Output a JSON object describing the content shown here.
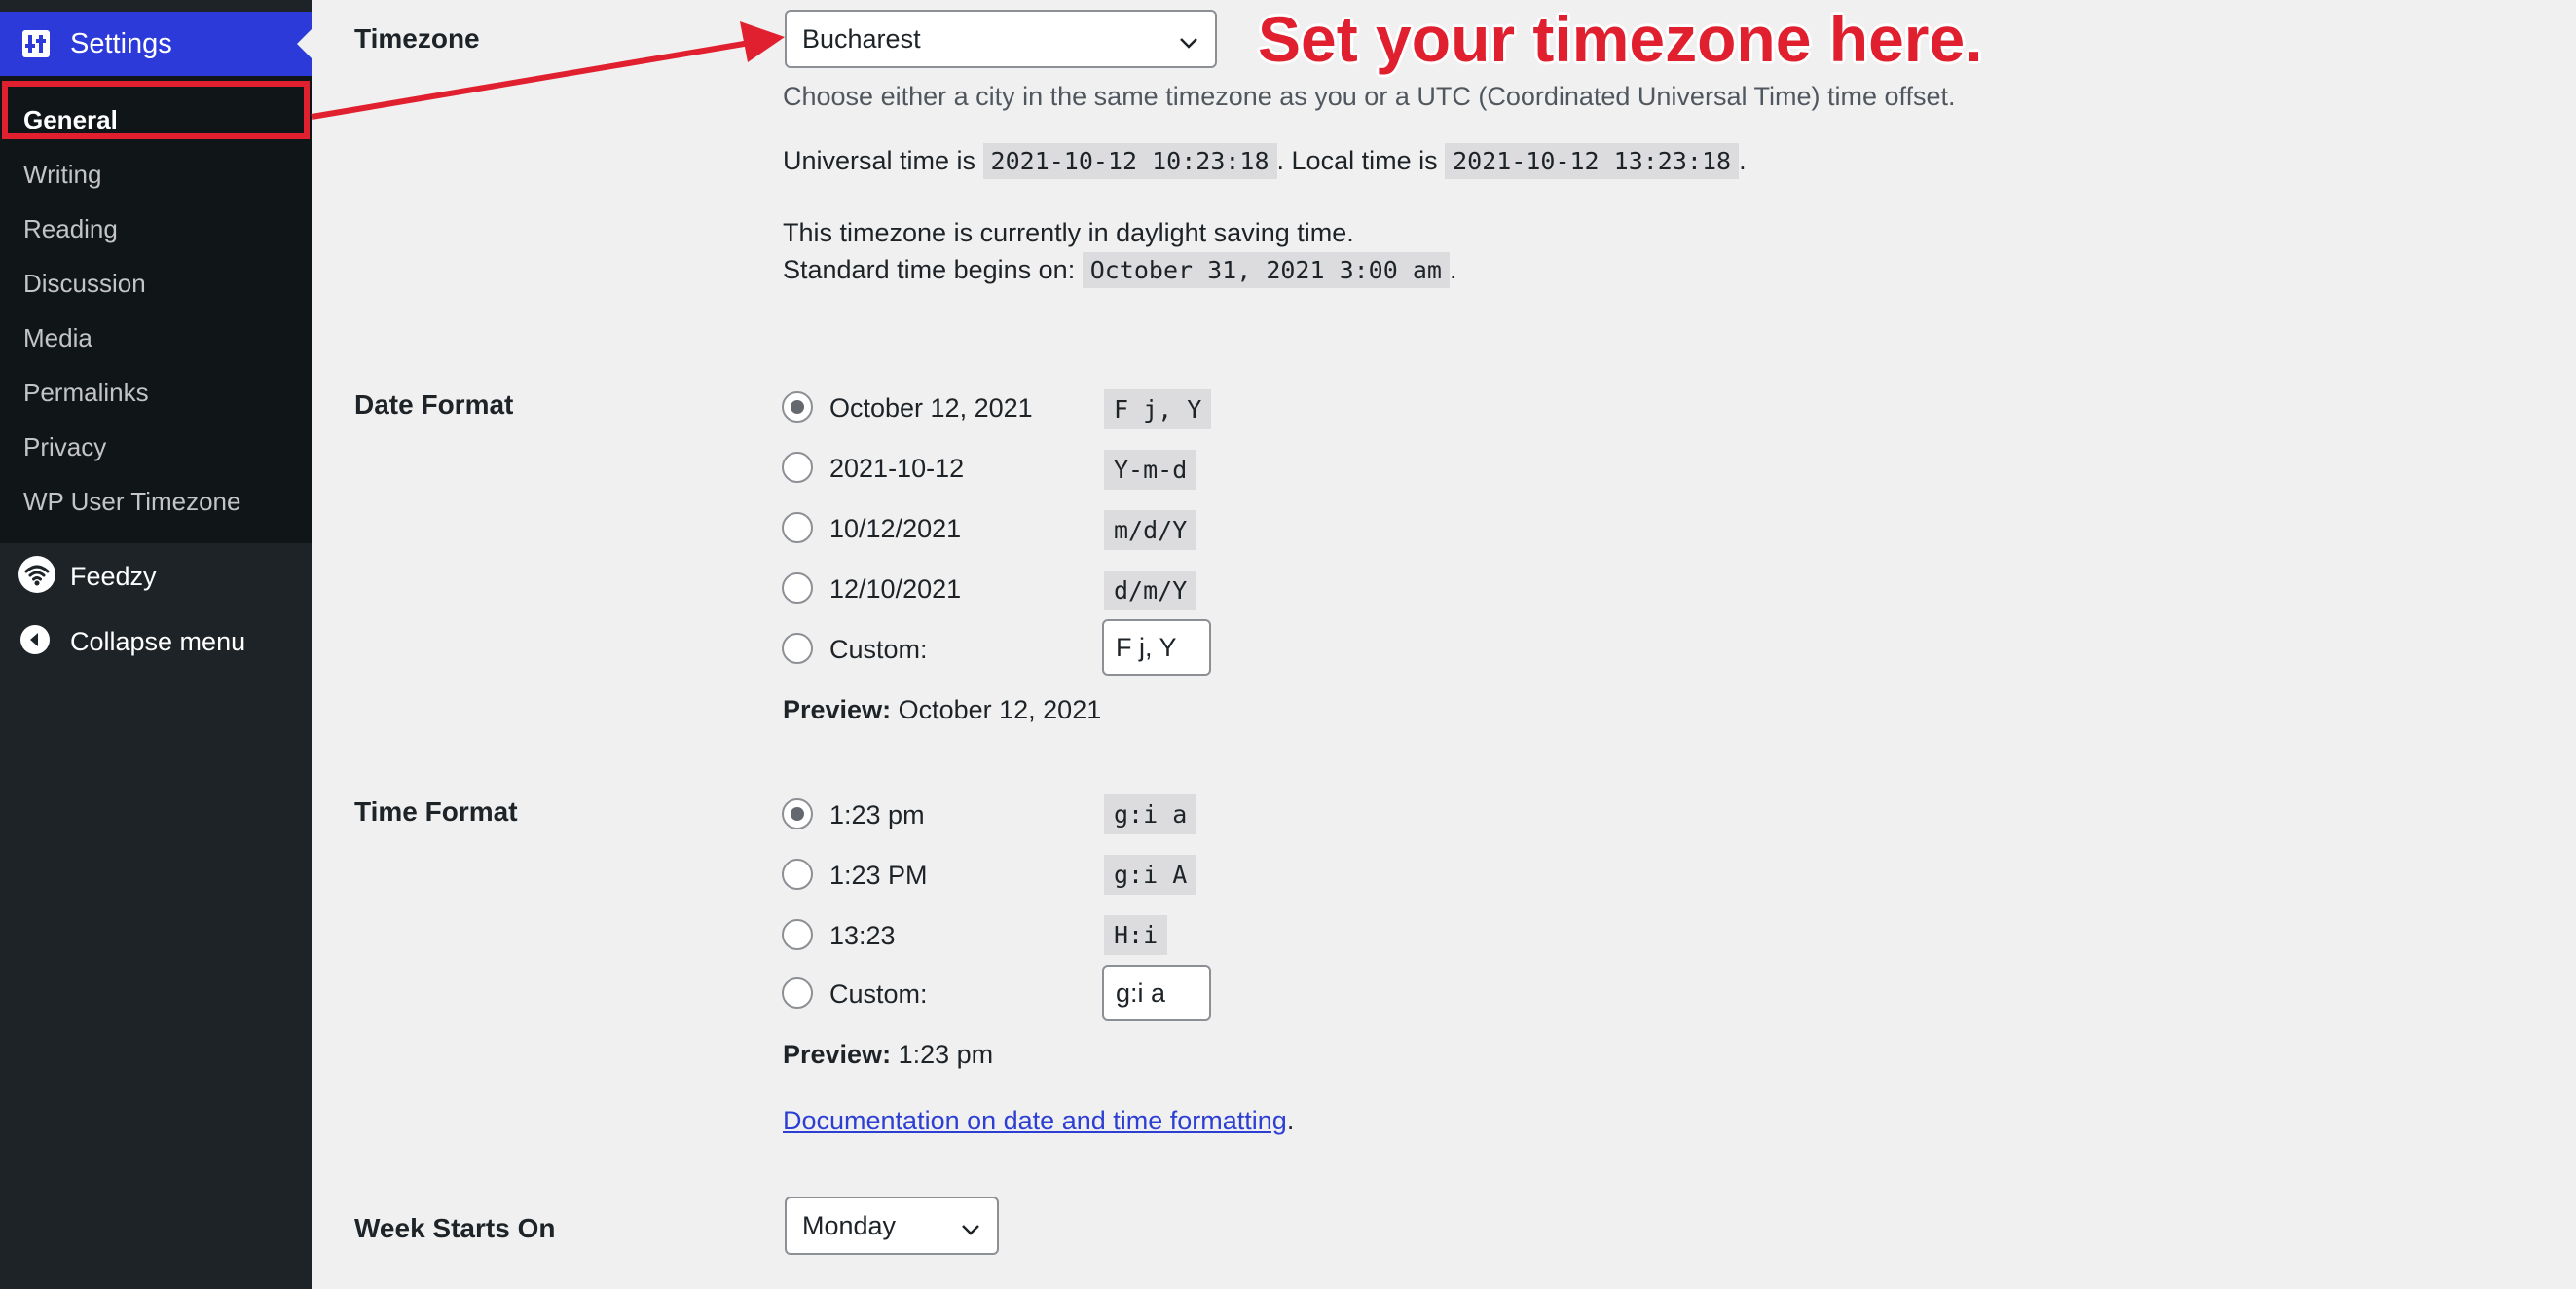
{
  "sidebar": {
    "settings_label": "Settings",
    "items": [
      {
        "label": "General",
        "active": true
      },
      {
        "label": "Writing"
      },
      {
        "label": "Reading"
      },
      {
        "label": "Discussion"
      },
      {
        "label": "Media"
      },
      {
        "label": "Permalinks"
      },
      {
        "label": "Privacy"
      },
      {
        "label": "WP User Timezone"
      }
    ],
    "feedzy_label": "Feedzy",
    "collapse_label": "Collapse menu"
  },
  "timezone": {
    "label": "Timezone",
    "selected": "Bucharest",
    "description": "Choose either a city in the same timezone as you or a UTC (Coordinated Universal Time) time offset.",
    "universal_prefix": "Universal time is ",
    "universal_time": "2021-10-12 10:23:18",
    "local_prefix": ". Local time is ",
    "local_time": "2021-10-12 13:23:18",
    "dst_line": "This timezone is currently in daylight saving time.",
    "standard_prefix": "Standard time begins on: ",
    "standard_time": "October 31, 2021 3:00 am",
    "period": "."
  },
  "annotation": {
    "callout": "Set your timezone here.",
    "accent_color": "#e1202f"
  },
  "date_format": {
    "label": "Date Format",
    "options": [
      {
        "label": "October 12, 2021",
        "code": "F j, Y",
        "checked": true
      },
      {
        "label": "2021-10-12",
        "code": "Y-m-d"
      },
      {
        "label": "10/12/2021",
        "code": "m/d/Y"
      },
      {
        "label": "12/10/2021",
        "code": "d/m/Y"
      }
    ],
    "custom_label": "Custom:",
    "custom_value": "F j, Y",
    "preview_label": "Preview:",
    "preview_value": "October 12, 2021"
  },
  "time_format": {
    "label": "Time Format",
    "options": [
      {
        "label": "1:23 pm",
        "code": "g:i a",
        "checked": true
      },
      {
        "label": "1:23 PM",
        "code": "g:i A"
      },
      {
        "label": "13:23",
        "code": "H:i"
      }
    ],
    "custom_label": "Custom:",
    "custom_value": "g:i a",
    "preview_label": "Preview:",
    "preview_value": "1:23 pm",
    "doc_link": "Documentation on date and time formatting",
    "doc_suffix": "."
  },
  "week": {
    "label": "Week Starts On",
    "selected": "Monday"
  },
  "colors": {
    "sidebar_bg": "#1d2327",
    "submenu_bg": "#101517",
    "settings_highlight": "#2c3ad9",
    "link": "#2d3fd3",
    "page_bg": "#f0f0f1"
  }
}
